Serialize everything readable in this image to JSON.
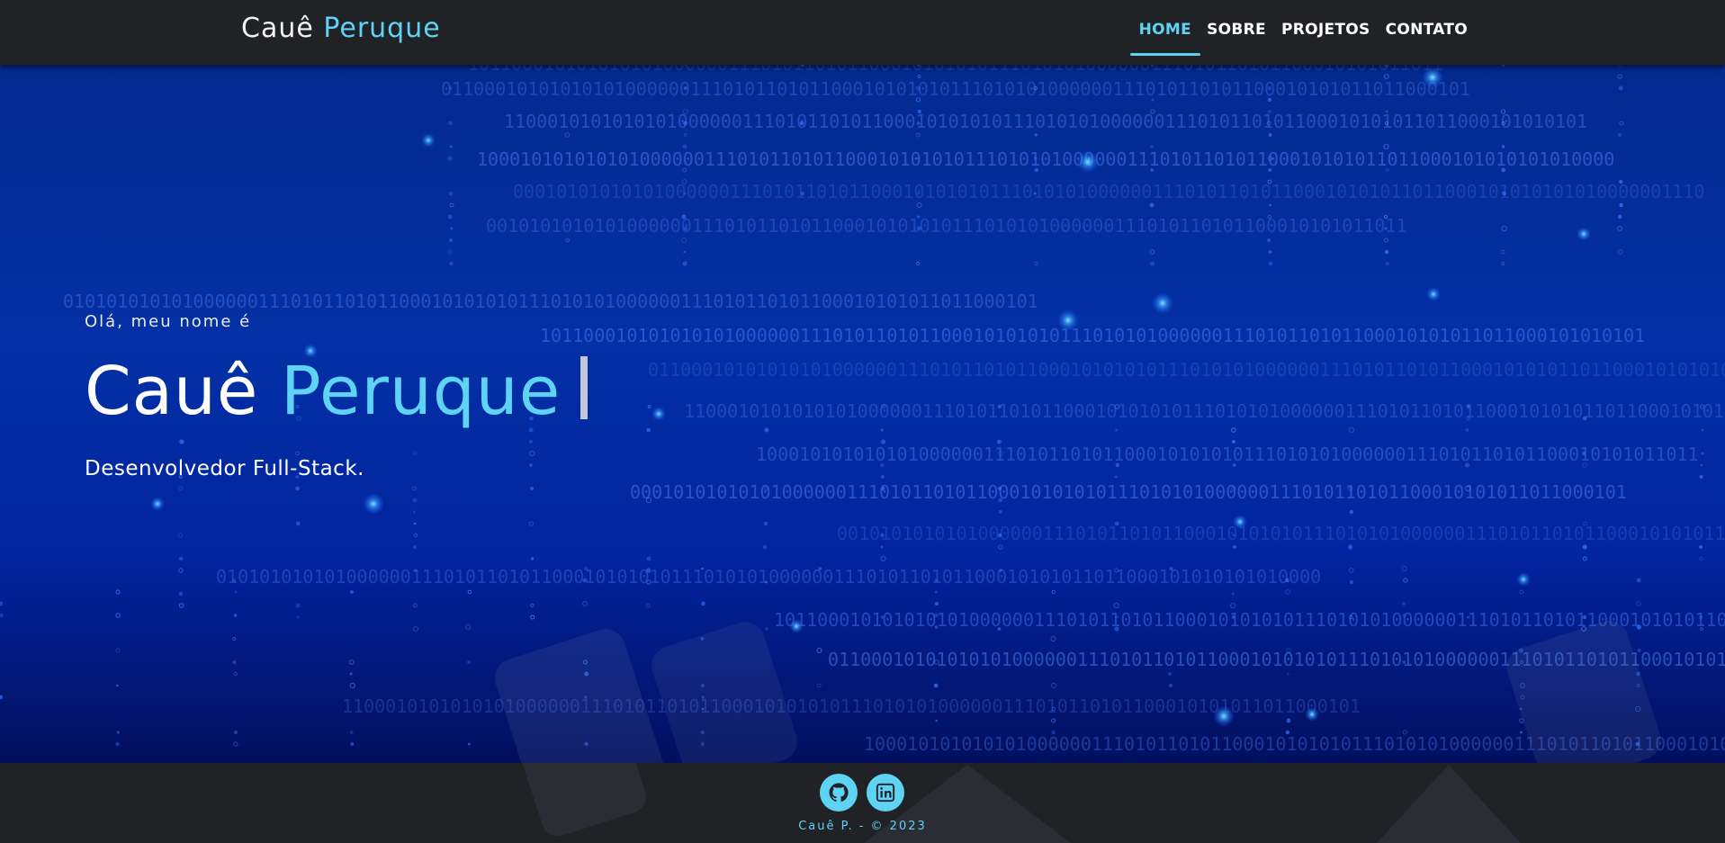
{
  "navbar": {
    "brand_first": "Cauê",
    "brand_last": "Peruque",
    "items": [
      {
        "label": "HOME",
        "active": true
      },
      {
        "label": "SOBRE",
        "active": false
      },
      {
        "label": "PROJETOS",
        "active": false
      },
      {
        "label": "CONTATO",
        "active": false
      }
    ]
  },
  "hero": {
    "greeting": "Olá, meu nome é",
    "name_first": "Cauê",
    "name_last": "Peruque",
    "subtitle": "Desenvolvedor Full-Stack.",
    "binary_text": "10110001010101010100000011101011010110001010101011101010100000011101011010110001010101"
  },
  "footer": {
    "socials": [
      {
        "icon": "github-icon"
      },
      {
        "icon": "linkedin-icon"
      }
    ],
    "copyright": "Cauê P. - © 2023"
  },
  "colors": {
    "accent": "#5fd3f3",
    "dark": "#202226",
    "hero_blue": "#0330a5"
  }
}
